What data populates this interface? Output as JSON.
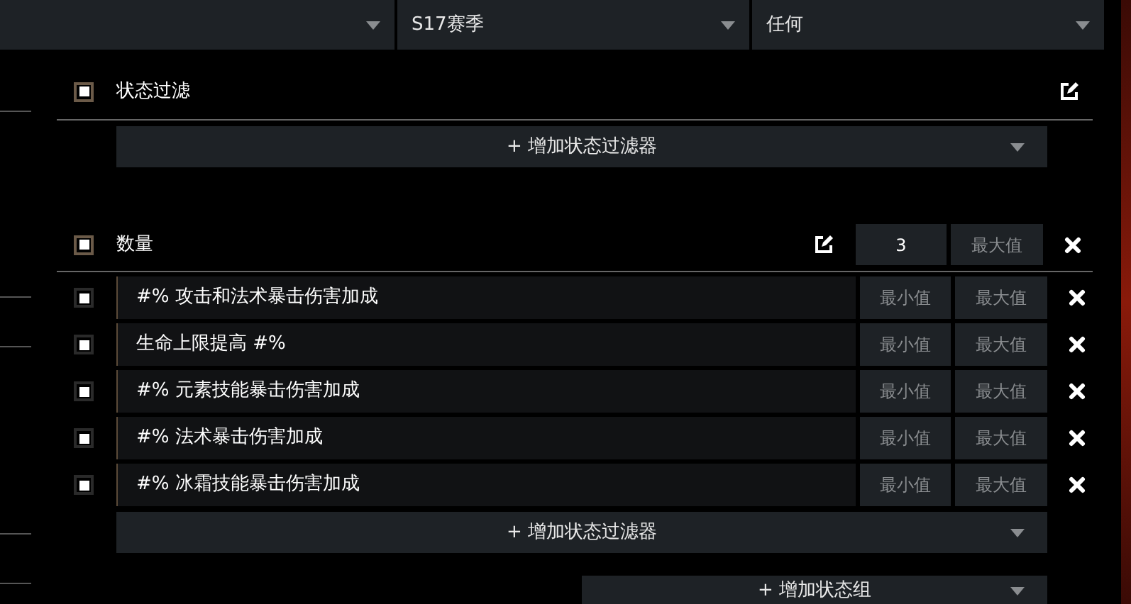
{
  "top_dropdowns": [
    {
      "kind": "blank"
    },
    {
      "kind": "select",
      "value": "S17赛季"
    },
    {
      "kind": "select",
      "value": "任何"
    }
  ],
  "status_filter": {
    "title": "状态过滤",
    "checked": true,
    "add_button": "+ 增加状态过滤器"
  },
  "count_group": {
    "title": "数量",
    "checked": true,
    "min_value": "3",
    "max_placeholder": "最大值",
    "rows": [
      {
        "label": "#% 攻击和法术暴击伤害加成",
        "checked": true,
        "min_placeholder": "最小值",
        "max_placeholder": "最大值"
      },
      {
        "label": "生命上限提高 #%",
        "checked": true,
        "min_placeholder": "最小值",
        "max_placeholder": "最大值"
      },
      {
        "label": "#% 元素技能暴击伤害加成",
        "checked": true,
        "min_placeholder": "最小值",
        "max_placeholder": "最大值"
      },
      {
        "label": "#% 法术暴击伤害加成",
        "checked": true,
        "min_placeholder": "最小值",
        "max_placeholder": "最大值"
      },
      {
        "label": "#% 冰霜技能暴击伤害加成",
        "checked": true,
        "min_placeholder": "最小值",
        "max_placeholder": "最大值"
      }
    ],
    "add_button": "+ 增加状态过滤器"
  },
  "add_group_button": "+ 增加状态组"
}
